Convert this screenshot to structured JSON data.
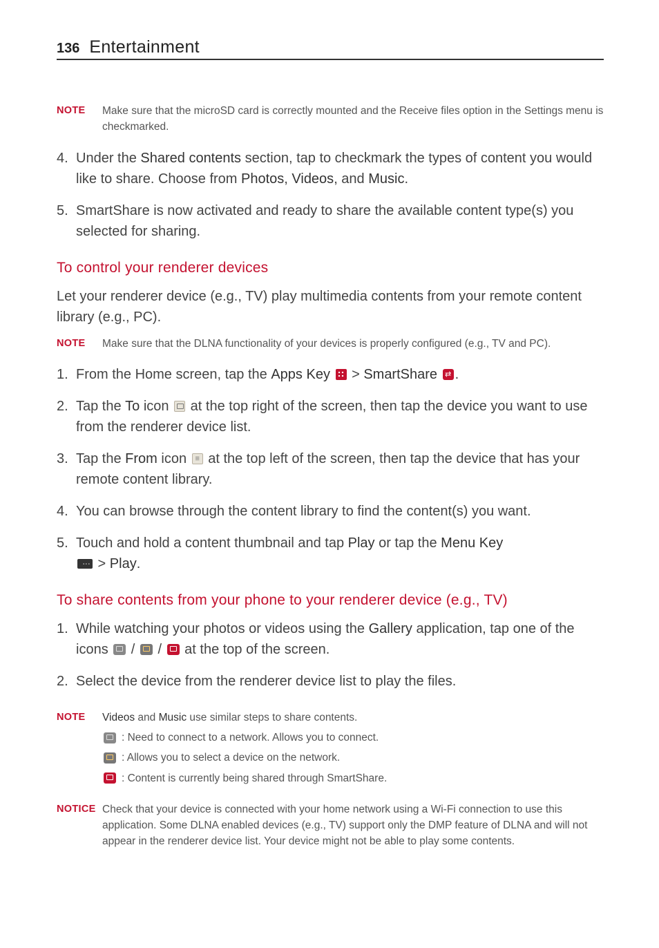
{
  "page": {
    "number": "136",
    "section": "Entertainment"
  },
  "note1": {
    "label": "NOTE",
    "text": "Make sure that the microSD card is correctly mounted and the Receive files option in the Settings menu is checkmarked."
  },
  "stepsA": {
    "s4_pre": "Under the ",
    "s4_b1": "Shared contents",
    "s4_mid": " section, tap to checkmark the types of content you would like to share. Choose from ",
    "s4_b2": "Photos",
    "s4_c": ", ",
    "s4_b3": "Videos",
    "s4_and": ", and ",
    "s4_b4": "Music",
    "s4_post": ".",
    "s5": "SmartShare is now activated and ready to share the available content type(s) you selected for sharing."
  },
  "h2a": "To control your renderer devices",
  "introA": "Let your renderer device (e.g., TV) play multimedia contents from your remote content library (e.g., PC).",
  "note2": {
    "label": "NOTE",
    "text": "Make sure that the DLNA functionality of your devices is properly configured (e.g., TV and PC)."
  },
  "stepsB": {
    "s1_pre": "From the Home screen, tap the ",
    "s1_b1": "Apps Key ",
    "s1_gt": " > ",
    "s1_b2": "SmartShare ",
    "s1_post": ".",
    "s2_pre": "Tap the ",
    "s2_b1": "To",
    "s2_mid": " icon ",
    "s2_post": " at the top right of the screen, then tap the device you want to use from the renderer device list.",
    "s3_pre": "Tap the ",
    "s3_b1": "From",
    "s3_mid": " icon ",
    "s3_post": " at the top left of the screen, then tap the device that has your remote content library.",
    "s4": "You can browse through the content library to find the content(s) you want.",
    "s5_pre": "Touch and hold a content thumbnail and tap ",
    "s5_b1": "Play",
    "s5_mid": " or tap the ",
    "s5_b2": "Menu Key ",
    "s5_gt": " > ",
    "s5_b3": "Play",
    "s5_post": "."
  },
  "h2b": "To share contents from your phone to your renderer device (e.g., TV)",
  "stepsC": {
    "s1_pre": "While watching your photos or videos using the ",
    "s1_b1": "Gallery",
    "s1_mid": " application, tap one of the icons ",
    "s1_sep": " / ",
    "s1_post": " at the top of the screen.",
    "s2": "Select the device from the renderer device list to play the files."
  },
  "note3": {
    "label": "NOTE",
    "b1": "Videos",
    "mid": " and ",
    "b2": "Music",
    "post": " use similar steps to share contents.",
    "line1": " : Need to connect to a network. Allows you to connect.",
    "line2": " : Allows you to select a device on the network.",
    "line3": " : Content is currently being shared through SmartShare."
  },
  "notice": {
    "label": "NOTICE",
    "text": "Check that your device is connected with your home network using a Wi-Fi connection to use this application. Some DLNA enabled devices (e.g., TV) support only the DMP feature of DLNA and will not appear in the renderer device list. Your device might not be able to play some contents."
  }
}
